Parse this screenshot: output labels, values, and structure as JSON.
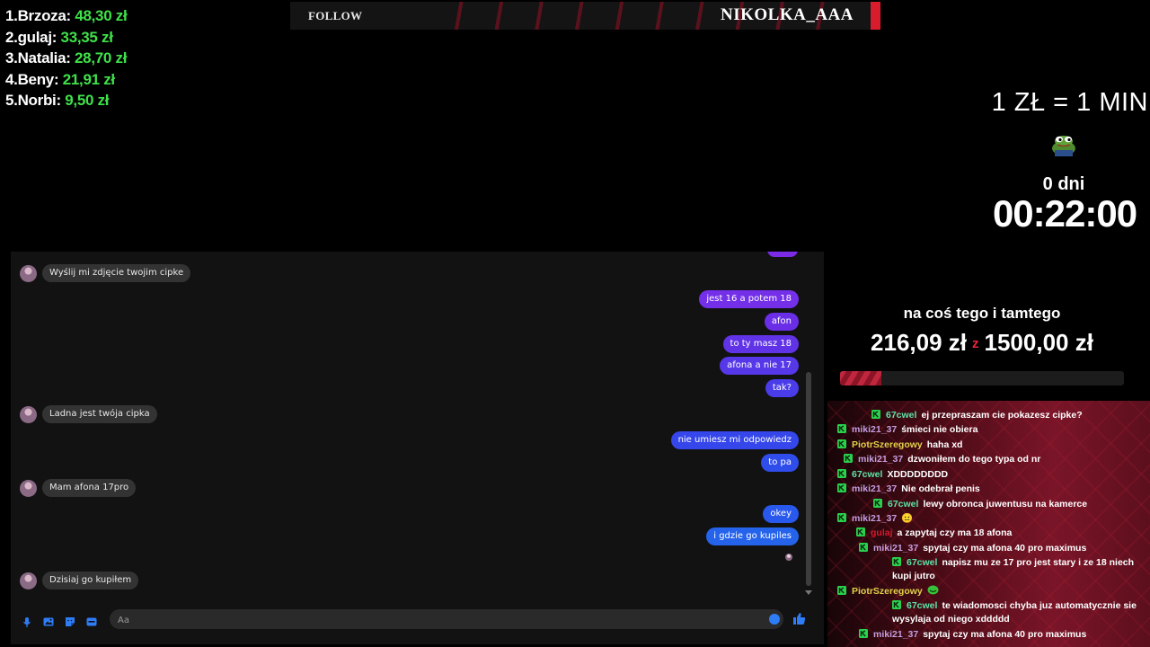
{
  "leaderboard": [
    {
      "rank": "1.",
      "name": "Brzoza:",
      "amount": "48,30 zł"
    },
    {
      "rank": "2.",
      "name": "gulaj:",
      "amount": "33,35 zł"
    },
    {
      "rank": "3.",
      "name": "Natalia:",
      "amount": "28,70 zł"
    },
    {
      "rank": "4.",
      "name": "Beny:",
      "amount": "21,91 zł"
    },
    {
      "rank": "5.",
      "name": "Norbi:",
      "amount": "9,50 zł"
    }
  ],
  "follow": {
    "label": "FOLLOW",
    "name": "NIKOLKA_AAA"
  },
  "subathon": {
    "rate": "1 ZŁ = 1 MIN",
    "days": "0 dni",
    "timer": "00:22:00"
  },
  "goal": {
    "title": "na coś tego i tamtego",
    "current": "216,09 zł",
    "separator": "z",
    "target": "1500,00 zł",
    "progress_fraction": 0.144
  },
  "colors": {
    "leader_amount": "#3fe14a",
    "accent_red": "#d81c2c",
    "bubble_purple": "#6a2ee6",
    "bubble_blue": "#2563eb",
    "bubble_gray": "#333334"
  },
  "chat": [
    {
      "user": "67cwel",
      "color": "#5ee3a7",
      "text": "ej przepraszam cie pokazesz cipke?"
    },
    {
      "user": "miki21_37",
      "color": "#c79ee0",
      "text": "śmieci nie obiera"
    },
    {
      "user": "PiotrSzeregowy",
      "color": "#e2d14a",
      "text": "haha xd"
    },
    {
      "user": "miki21_37",
      "color": "#c79ee0",
      "text": "dzwoniłem do tego typa od nr"
    },
    {
      "user": "67cwel",
      "color": "#5ee3a7",
      "text": "XDDDDDDDD"
    },
    {
      "user": "miki21_37",
      "color": "#c79ee0",
      "text": "Nie odebrał penis"
    },
    {
      "user": "67cwel",
      "color": "#5ee3a7",
      "text": "lewy obronca juwentusu na kamerce"
    },
    {
      "user": "miki21_37",
      "color": "#c79ee0",
      "text": "😐"
    },
    {
      "user": "gulaj",
      "color": "#d41a2c",
      "text": "a zapytaj czy ma 18 afona"
    },
    {
      "user": "miki21_37",
      "color": "#c79ee0",
      "text": "spytaj czy ma afona 40 pro maximus"
    },
    {
      "user": "67cwel",
      "color": "#5ee3a7",
      "text": "napisz mu ze 17 pro jest stary i ze 18 niech kupi jutro"
    },
    {
      "user": "PiotrSzeregowy",
      "color": "#e2d14a",
      "text": ""
    },
    {
      "user": "67cwel",
      "color": "#5ee3a7",
      "text": "te wiadomosci chyba juz automatycznie sie wysylaja od niego xddddd"
    },
    {
      "user": "miki21_37",
      "color": "#c79ee0",
      "text": "spytaj czy ma afona 40 pro maximus"
    }
  ],
  "messenger": {
    "incoming": [
      "Wyślij mi zdjęcie twojim cipke",
      "Ladna jest twója cipka",
      "Mam afona 17pro",
      "Dzisiaj go kupiłem"
    ],
    "outgoing": [
      "jest 16 a potem 18",
      "afon",
      "to ty masz 18",
      "afona a nie 17",
      "tak?",
      "nie umiesz mi odpowiedz",
      "to pa",
      "okey",
      "i gdzie go kupiles"
    ],
    "input_placeholder": "Aa"
  }
}
